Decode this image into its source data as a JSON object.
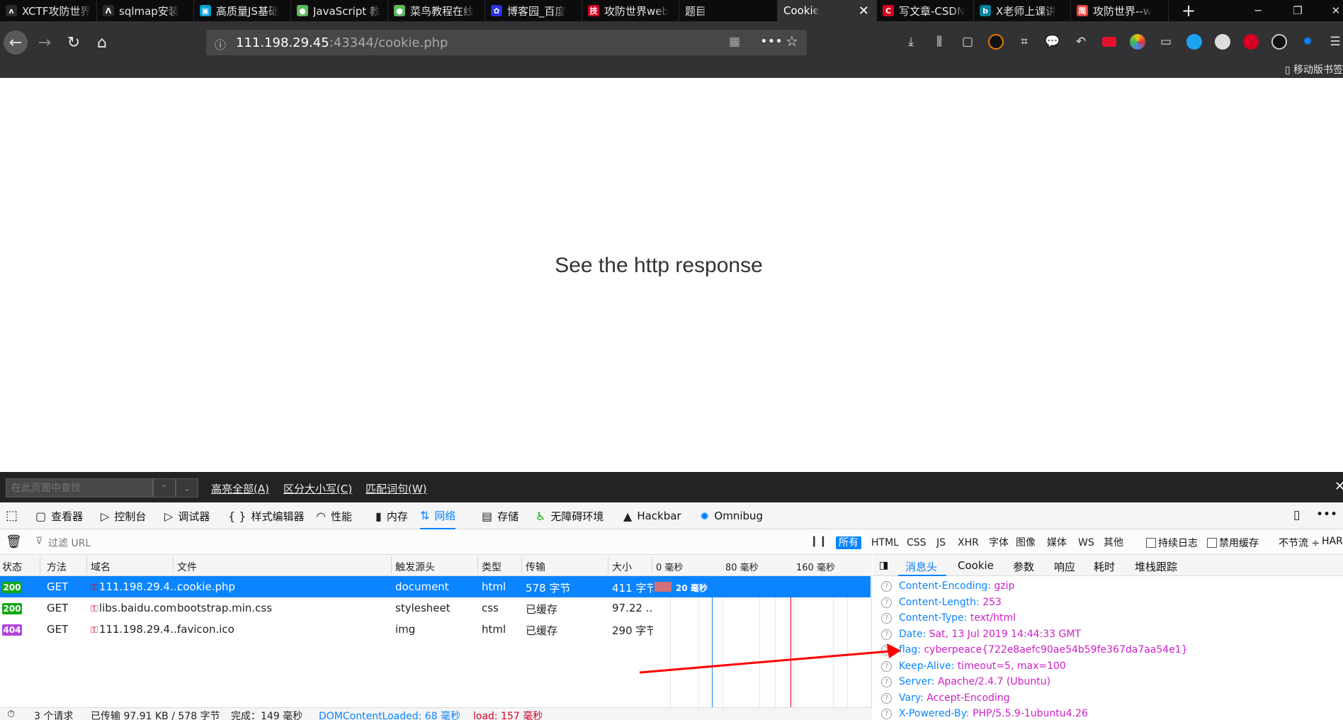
{
  "tabs": [
    {
      "title": "XCTF攻防世界",
      "color": "#2a2a2e",
      "glyph": "ʌ"
    },
    {
      "title": "sqlmap安装",
      "color": "#2a2a2e",
      "glyph": "Λ"
    },
    {
      "title": "高质量JS基础",
      "color": "#00a1d6",
      "glyph": "▣"
    },
    {
      "title": "JavaScript 教",
      "color": "#5cb85c",
      "glyph": "●"
    },
    {
      "title": "菜鸟教程在线",
      "color": "#5cb85c",
      "glyph": "●"
    },
    {
      "title": "博客园_百度",
      "color": "#2932e1",
      "glyph": "✿"
    },
    {
      "title": "攻防世界web",
      "color": "#d70022",
      "glyph": "技"
    },
    {
      "title": "题目",
      "color": "#0c0c0d",
      "glyph": ""
    },
    {
      "title": "Cookie",
      "color": "#323234",
      "glyph": ""
    },
    {
      "title": "写文章-CSDN",
      "color": "#d70022",
      "glyph": "C"
    },
    {
      "title": "X老师上课讲",
      "color": "#00809d",
      "glyph": "b"
    },
    {
      "title": "攻防世界--w",
      "color": "#e8433e",
      "glyph": "简"
    }
  ],
  "nav": {
    "url_host": "111.198.29.45",
    "url_rest": ":43344/cookie.php",
    "bookmark_folder": "移动版书签"
  },
  "page": {
    "heading": "See the http response"
  },
  "findbar": {
    "placeholder": "在此页面中查找",
    "highlight_all": "高亮全部(A)",
    "match_case": "区分大小写(C)",
    "whole_words": "匹配词句(W)"
  },
  "devtools": {
    "tabs": [
      {
        "label": "查看器",
        "icon": "inspector-icon"
      },
      {
        "label": "控制台",
        "icon": "console-icon"
      },
      {
        "label": "调试器",
        "icon": "debugger-icon"
      },
      {
        "label": "样式编辑器",
        "icon": "style-editor-icon"
      },
      {
        "label": "性能",
        "icon": "performance-icon"
      },
      {
        "label": "内存",
        "icon": "memory-icon"
      },
      {
        "label": "网络",
        "icon": "network-icon"
      },
      {
        "label": "存储",
        "icon": "storage-icon"
      },
      {
        "label": "无障碍环境",
        "icon": "accessibility-icon"
      },
      {
        "label": "Hackbar",
        "icon": "hackbar-icon"
      },
      {
        "label": "Omnibug",
        "icon": "omnibug-icon"
      }
    ],
    "filter_placeholder": "过滤 URL",
    "filter_types": [
      "所有",
      "HTML",
      "CSS",
      "JS",
      "XHR",
      "字体",
      "图像",
      "媒体",
      "WS",
      "其他"
    ],
    "persist_logs": "持续日志",
    "disable_cache": "禁用缓存",
    "throttle": "不节流 ÷",
    "har": "HAR"
  },
  "netlist": {
    "columns": [
      "状态",
      "方法",
      "域名",
      "文件",
      "触发源头",
      "类型",
      "传输",
      "大小"
    ],
    "timeline_ticks": [
      "0 毫秒",
      "80 毫秒",
      "160 毫秒"
    ],
    "rows": [
      {
        "status": "200",
        "method": "GET",
        "domain": "111.198.29.4...",
        "file": "cookie.php",
        "cause": "document",
        "type": "html",
        "transferred": "578 字节",
        "size": "411 字节",
        "timing": "20 毫秒"
      },
      {
        "status": "200",
        "method": "GET",
        "domain": "libs.baidu.com",
        "file": "bootstrap.min.css",
        "cause": "stylesheet",
        "type": "css",
        "transferred": "已缓存",
        "size": "97.22 ...",
        "timing": ""
      },
      {
        "status": "404",
        "method": "GET",
        "domain": "111.198.29.4...",
        "file": "favicon.ico",
        "cause": "img",
        "type": "html",
        "transferred": "已缓存",
        "size": "290 字节",
        "timing": ""
      }
    ],
    "status_colors": {
      "200": "#12a812",
      "404": "#b344db"
    }
  },
  "sidepanel": {
    "tabs": [
      "消息头",
      "Cookie",
      "参数",
      "响应",
      "耗时",
      "堆栈跟踪"
    ],
    "headers": [
      {
        "k": "Content-Encoding:",
        "v": "gzip"
      },
      {
        "k": "Content-Length:",
        "v": "253"
      },
      {
        "k": "Content-Type:",
        "v": "text/html"
      },
      {
        "k": "Date:",
        "v": "Sat, 13 Jul 2019 14:44:33 GMT"
      },
      {
        "k": "flag:",
        "v": "cyberpeace{722e8aefc90ae54b59fe367da7aa54e1}"
      },
      {
        "k": "Keep-Alive:",
        "v": "timeout=5, max=100"
      },
      {
        "k": "Server:",
        "v": "Apache/2.4.7 (Ubuntu)"
      },
      {
        "k": "Vary:",
        "v": "Accept-Encoding"
      },
      {
        "k": "X-Powered-By:",
        "v": "PHP/5.5.9-1ubuntu4.26"
      }
    ]
  },
  "statusbar": {
    "requests": "3 个请求",
    "transferred": "已传输 97.91 KB / 578 字节",
    "finish": "完成：149 毫秒",
    "dcl": "DOMContentLoaded: 68 毫秒",
    "load": "load: 157 毫秒"
  }
}
